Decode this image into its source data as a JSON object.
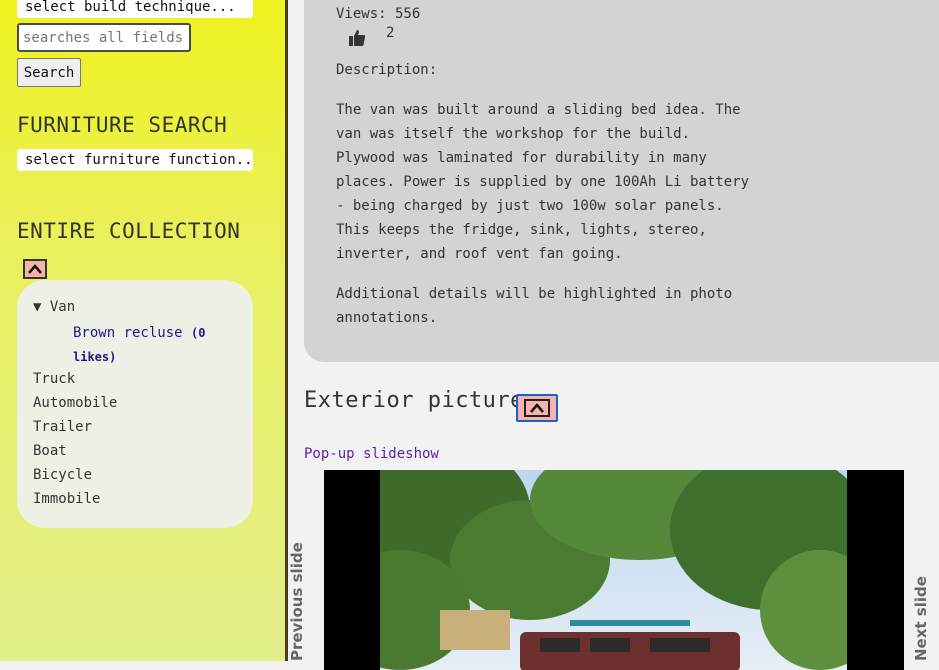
{
  "sidebar": {
    "build_select_value": "select build technique...",
    "search_placeholder": "searches all fields...",
    "search_button": "Search",
    "furniture_heading": "FURNITURE SEARCH",
    "furniture_select_value": "select furniture function...",
    "collection_heading": "ENTIRE COLLECTION",
    "collection_up_icon": "chevron-up-icon",
    "tree": {
      "van_label": "▼ Van",
      "van_child_name": "Brown recluse",
      "van_child_likes": "(0 likes)",
      "items": [
        "Truck",
        "Automobile",
        "Trailer",
        "Boat",
        "Bicycle",
        "Immobile"
      ]
    }
  },
  "main": {
    "views": "Views: 556",
    "like_icon": "thumbs-up-icon",
    "like_count": "2",
    "description_label": "Description:",
    "description_p1": "The van was built around a sliding bed idea. The van was itself the workshop for the build. Plywood was laminated for durability in many places. Power is supplied by one 100Ah Li battery - being charged by just two 100w solar panels. This keeps the fridge, sink, lights, stereo, inverter, and roof vent fan going.",
    "description_p2": "Additional details will be highlighted in photo annotations.",
    "exterior_heading": "Exterior pictures",
    "exterior_up_icon": "chevron-up-icon",
    "slideshow_link": "Pop-up slideshow",
    "prev_label": "Previous slide",
    "next_label": "Next slide"
  },
  "colors": {
    "sidebar_top": "#eef21e",
    "sidebar_bottom": "#e2ef8a",
    "card": "#d3d3d3",
    "up_button": "#f4b3a3",
    "link": "#5a1fb0"
  }
}
